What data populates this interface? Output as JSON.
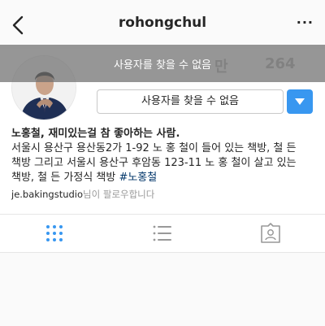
{
  "header": {
    "title": "rohongchul",
    "back_icon": "chevron-left-icon",
    "more_label": "···"
  },
  "profile": {
    "followers_count": "264",
    "stat_faded": "만"
  },
  "banner": {
    "text": "사용자를 찾을 수 없음"
  },
  "follow_button": {
    "label": "사용자를 찾을 수 없음"
  },
  "bio": {
    "name": "노홍철, 재미있는걸 참 좋아하는 사람.",
    "line1": "서울시 용산구 용산동2가 1-92 노 홍 철이 들어 있는 책방, 철 든",
    "line2": "책방 그리고 서울시 용산구 후암동 123-11 노 홍 철이 살고 있는",
    "line3_prefix": "책방, 철 든 가정식 책방 ",
    "hashtag": "#노홍철"
  },
  "followed_by": {
    "user": "je.bakingstudio",
    "suffix": "님이 팔로우합니다"
  },
  "tabs": [
    {
      "icon": "grid-icon"
    },
    {
      "icon": "list-icon"
    },
    {
      "icon": "tagged-icon"
    }
  ],
  "colors": {
    "accent": "#3897f0",
    "active_tab": "#3897f0",
    "inactive_tab": "#999999"
  }
}
